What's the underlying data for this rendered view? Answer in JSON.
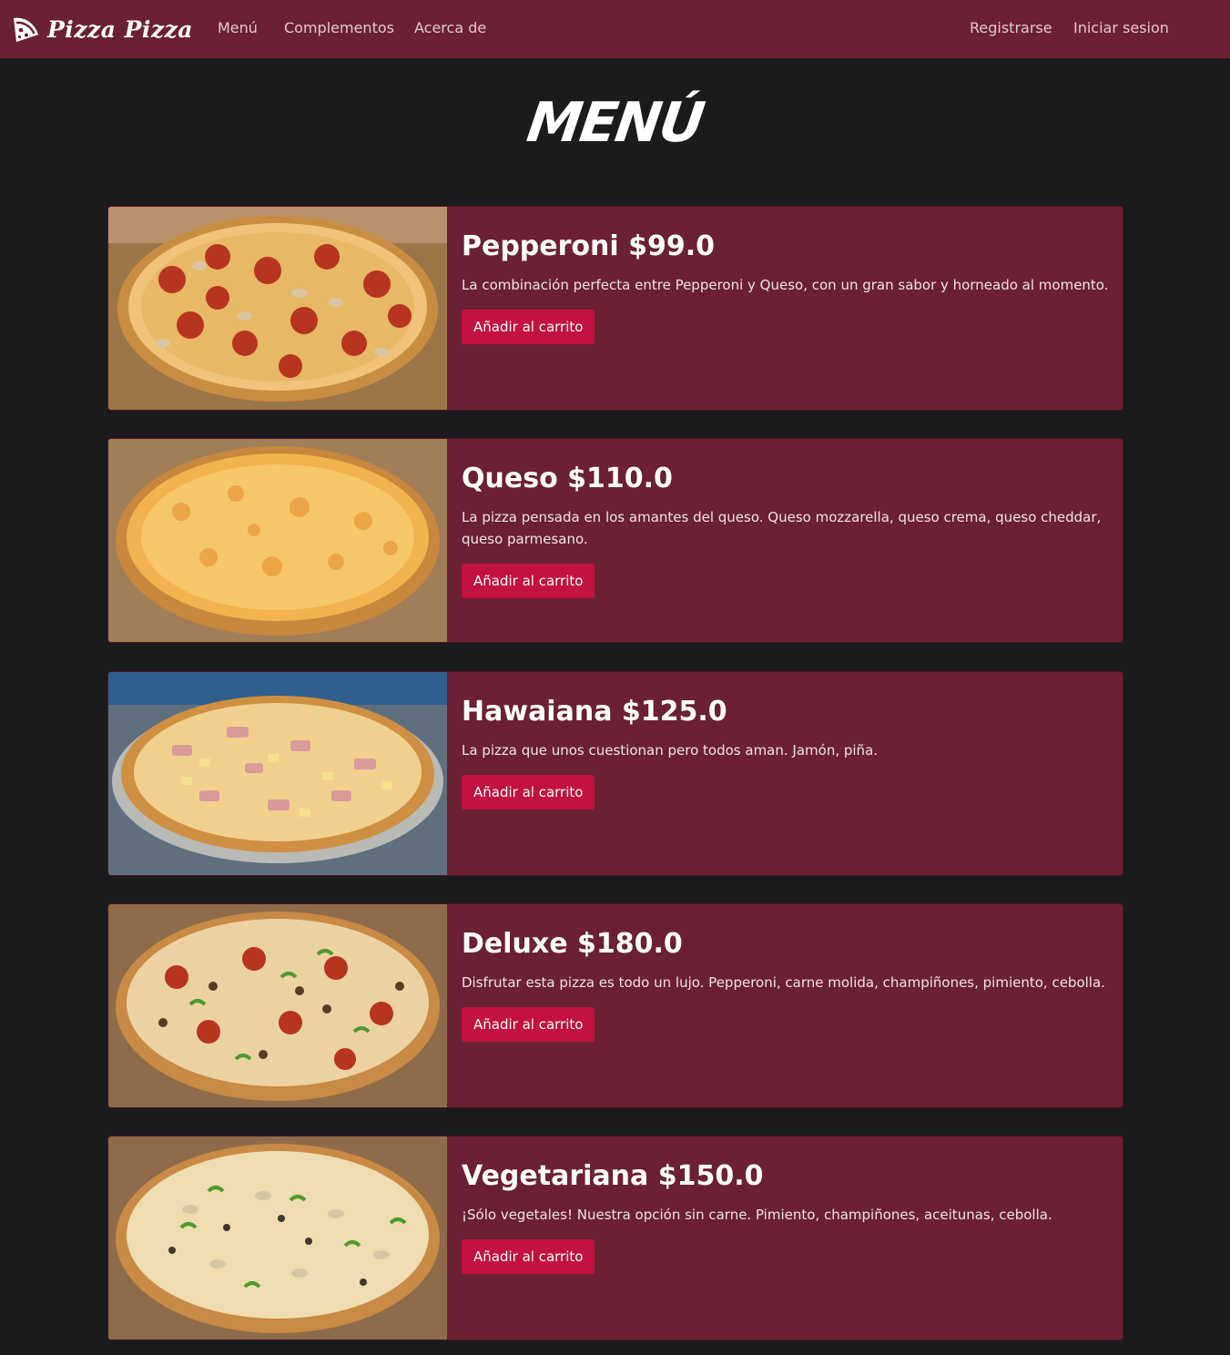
{
  "navbar": {
    "brand": "Pizza Pizza",
    "brand_icon": "pizza-slice-icon",
    "links": [
      "Menú",
      "Complementos",
      "Acerca de"
    ],
    "auth_links": [
      "Registrarse",
      "Iniciar sesion"
    ]
  },
  "page": {
    "title": "Menú"
  },
  "colors": {
    "background": "#1b1b1d",
    "navbar": "#6b2033",
    "card": "#6b2033",
    "button": "#c3123f"
  },
  "menu": [
    {
      "name": "Pepperoni",
      "price": "$99.0",
      "title": "Pepperoni $99.0",
      "description": "La combinación perfecta entre Pepperoni y Queso, con un gran sabor y horneado al momento.",
      "button": "Añadir al carrito",
      "image": "pepperoni-pizza-photo"
    },
    {
      "name": "Queso",
      "price": "$110.0",
      "title": "Queso $110.0",
      "description": "La pizza pensada en los amantes del queso. Queso mozzarella, queso crema, queso cheddar, queso parmesano.",
      "button": "Añadir al carrito",
      "image": "cheese-pizza-photo"
    },
    {
      "name": "Hawaiana",
      "price": "$125.0",
      "title": "Hawaiana $125.0",
      "description": "La pizza que unos cuestionan pero todos aman. Jamón, piña.",
      "button": "Añadir al carrito",
      "image": "hawaiian-pizza-photo"
    },
    {
      "name": "Deluxe",
      "price": "$180.0",
      "title": "Deluxe $180.0",
      "description": "Disfrutar esta pizza es todo un lujo. Pepperoni, carne molida, champiñones, pimiento, cebolla.",
      "button": "Añadir al carrito",
      "image": "deluxe-pizza-photo"
    },
    {
      "name": "Vegetariana",
      "price": "$150.0",
      "title": "Vegetariana $150.0",
      "description": "¡Sólo vegetales! Nuestra opción sin carne. Pimiento, champiñones, aceitunas, cebolla.",
      "button": "Añadir al carrito",
      "image": "vegetarian-pizza-photo"
    }
  ]
}
